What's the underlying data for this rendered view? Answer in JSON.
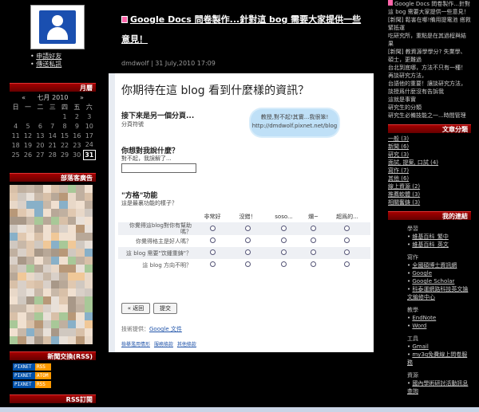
{
  "left": {
    "links": [
      "申請好友",
      "傳送私訊"
    ],
    "calendar": {
      "header": "月曆",
      "prev": "«",
      "month": "七月 2010",
      "next": "»",
      "weekdays": [
        "日",
        "一",
        "二",
        "三",
        "四",
        "五",
        "六"
      ],
      "weeks": [
        [
          "",
          "",
          "",
          "",
          "1",
          "2",
          "3"
        ],
        [
          "4",
          "5",
          "6",
          "7",
          "8",
          "9",
          "10"
        ],
        [
          "11",
          "12",
          "13",
          "14",
          "15",
          "16",
          "17"
        ],
        [
          "18",
          "19",
          "20",
          "21",
          "22",
          "23",
          "24"
        ],
        [
          "25",
          "26",
          "27",
          "28",
          "29",
          "30",
          "31"
        ]
      ],
      "today": "31"
    },
    "ads_header": "部落客廣告",
    "rss_header": "新聞交換(RSS)",
    "rss_buttons": [
      {
        "left": "PIXNET",
        "right": "RSS"
      },
      {
        "left": "PIXNET",
        "right": "ATOM"
      },
      {
        "left": "PIXNET",
        "right": "RSS"
      }
    ],
    "rss2_header": "RSS訂閱"
  },
  "post": {
    "title": "Google Docs 問卷製作...針對這 bog 需要大家提供一些意見！",
    "meta": "dmdwolf | 31 July,2010 17:09"
  },
  "form": {
    "title": "你期待在這 blog 看到什麼樣的資訊？",
    "section1_title": "接下來是另一個分頁...",
    "section1_sub": "分頁符號",
    "cloud_line1": "教授,對不起!其實...我很笨!",
    "cloud_line2": "http://dmdwolf.pixnet.net/blog",
    "q1_title": "你想對我說什麼？",
    "q1_sub": "對不起，我誤解了...",
    "q2_title": "\"方格\"功能",
    "q2_sub": "這是最裏功能的樣子？",
    "columns": [
      "",
      "非常好",
      "沒錯！",
      "soso...",
      "爛~",
      "超爲的..."
    ],
    "rows": [
      "你覺得這blog對你有幫助嗎？",
      "你覺得格主是好人嗎？",
      "這 blog 需要\"饮鍾重鋳\"？",
      "這 blog 方向不明？"
    ],
    "back_button": "« 返回",
    "submit_button": "提交",
    "powered_prefix": "技術提供：",
    "powered_link": "Google 文件",
    "footer_links": [
      "檢舉濫用情形",
      "服務條款",
      "其他條款"
    ]
  },
  "right": {
    "recent": [
      "Google Docs 問卷製作...針對這 bog 需要大家提供一些意見！",
      "[新聞] 鬆害在哪!備用提電池 搭救緊抵運",
      "吃研究所，重點是在其過程與結果",
      "[新聞] 教資源學學分? 失業學、碩士，更難過",
      "台北到底哪，方法不只有一種！",
      "再談研究方法，",
      "台語他的重要！讓談研究方法，",
      "談授爲什麼沒有告訴我",
      "這就是事實",
      "研究生的分類",
      "研究生必備技能之一...時間管理"
    ],
    "categories_header": "文章分類",
    "categories": [
      "一般 (3)",
      "新聞 (6)",
      "研究 (3)",
      "面試, 提案, 口試 (4)",
      "寫作 (7)",
      "其他 (6)",
      "線上資源 (2)",
      "推薦軟體 (3)",
      "相關奮鋳 (3)"
    ],
    "links_header": "我的連結",
    "link_groups": [
      {
        "name": "學習",
        "items": [
          "維基百科_繁中",
          "維基百科_英文"
        ]
      },
      {
        "name": "寫作",
        "items": [
          "全國碩博士資訊網",
          "Google",
          "Google Scholar",
          "科泰運網路科技英文論文編修中心"
        ]
      },
      {
        "name": "教學",
        "items": [
          "EndNote",
          "Word"
        ]
      },
      {
        "name": "工具",
        "items": [
          "Gmail",
          "my3q免費線上問卷服務"
        ]
      },
      {
        "name": "資源",
        "items": [
          "國內學術研討活動訊息查詢"
        ]
      }
    ]
  },
  "colors": {
    "header_red": "#a40000",
    "page_bg": "#000000",
    "form_bg": "#ffffff"
  }
}
